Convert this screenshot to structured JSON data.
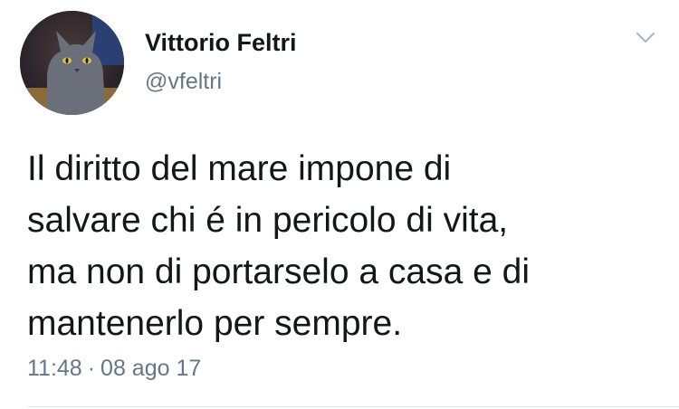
{
  "author": {
    "display_name": "Vittorio Feltri",
    "handle": "@vfeltri",
    "avatar_icon": "cat-avatar"
  },
  "tweet": {
    "lines": [
      "Il diritto del mare impone di",
      "salvare chi é in pericolo di vita,",
      "ma non di portarselo a casa e di",
      "mantenerlo per sempre."
    ],
    "time": "11:48",
    "separator": "·",
    "date": "08 ago 17"
  },
  "menu": {
    "icon": "chevron-down-icon"
  },
  "colors": {
    "text": "#14171a",
    "secondary": "#657786",
    "divider": "#e1e8ed"
  }
}
